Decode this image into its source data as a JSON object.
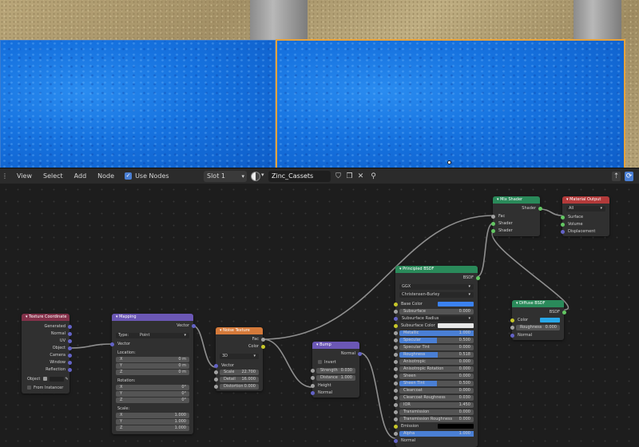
{
  "header": {
    "menus": [
      "View",
      "Select",
      "Add",
      "Node"
    ],
    "use_nodes_label": "Use Nodes",
    "slot_label": "Slot 1",
    "material_name": "Zinc_Cassets"
  },
  "nodes": {
    "texcoord": {
      "title": "Texture Coordinate",
      "outputs": [
        "Generated",
        "Normal",
        "UV",
        "Object",
        "Camera",
        "Window",
        "Reflection"
      ],
      "object_label": "Object",
      "from_instancer": "From Instancer"
    },
    "mapping": {
      "title": "Mapping",
      "output": "Vector",
      "type_label": "Type:",
      "type_value": "Point",
      "vector_input": "Vector",
      "location_label": "Location:",
      "location": [
        [
          "X",
          "0 m"
        ],
        [
          "Y",
          "0 m"
        ],
        [
          "Z",
          "0 m"
        ]
      ],
      "rotation_label": "Rotation:",
      "rotation": [
        [
          "X",
          "0°"
        ],
        [
          "Y",
          "0°"
        ],
        [
          "Z",
          "0°"
        ]
      ],
      "scale_label": "Scale:",
      "scale": [
        [
          "X",
          "1.000"
        ],
        [
          "Y",
          "1.000"
        ],
        [
          "Z",
          "1.000"
        ]
      ]
    },
    "noise": {
      "title": "Noise Texture",
      "outputs": [
        "Fac",
        "Color"
      ],
      "dimension": "3D",
      "vector_input": "Vector",
      "fields": [
        [
          "Scale",
          "22.700"
        ],
        [
          "Detail",
          "16.000"
        ],
        [
          "Distortion",
          "0.000"
        ]
      ]
    },
    "bump": {
      "title": "Bump",
      "output": "Normal",
      "invert": "Invert",
      "fields": [
        [
          "Strength",
          "0.030"
        ],
        [
          "Distance",
          "1.000"
        ]
      ],
      "inputs": [
        "Height",
        "Normal"
      ]
    },
    "principled": {
      "title": "Principled BSDF",
      "output": "BSDF",
      "distribution": "GGX",
      "subsurface_method": "Christensen-Burley",
      "rows": [
        {
          "label": "Base Color",
          "kind": "color",
          "color": "#3b82f0"
        },
        {
          "label": "Subsurface",
          "value": "0.000"
        },
        {
          "label": "Subsurface Radius",
          "kind": "select"
        },
        {
          "label": "Subsurface Color",
          "kind": "color",
          "color": "#e8e8e8"
        },
        {
          "label": "Metallic",
          "value": "1.000",
          "fill": 1.0
        },
        {
          "label": "Specular",
          "value": "0.500",
          "fill": 0.5
        },
        {
          "label": "Specular Tint",
          "value": "0.000"
        },
        {
          "label": "Roughness",
          "value": "0.518",
          "fill": 0.518
        },
        {
          "label": "Anisotropic",
          "value": "0.000"
        },
        {
          "label": "Anisotropic Rotation",
          "value": "0.000"
        },
        {
          "label": "Sheen",
          "value": "0.000"
        },
        {
          "label": "Sheen Tint",
          "value": "0.500",
          "fill": 0.5
        },
        {
          "label": "Clearcoat",
          "value": "0.000"
        },
        {
          "label": "Clearcoat Roughness",
          "value": "0.030"
        },
        {
          "label": "IOR",
          "value": "1.450"
        },
        {
          "label": "Transmission",
          "value": "0.000"
        },
        {
          "label": "Transmission Roughness",
          "value": "0.000"
        },
        {
          "label": "Emission",
          "kind": "color",
          "color": "#000000"
        },
        {
          "label": "Alpha",
          "value": "1.000",
          "fill": 1.0
        },
        {
          "label": "Normal",
          "kind": "socket"
        }
      ]
    },
    "mix": {
      "title": "Mix Shader",
      "output": "Shader",
      "inputs": [
        "Fac",
        "Shader",
        "Shader"
      ]
    },
    "output": {
      "title": "Material Output",
      "target": "All",
      "inputs": [
        "Surface",
        "Volume",
        "Displacement"
      ]
    },
    "diffuse": {
      "title": "Diffuse BSDF",
      "output": "BSDF",
      "color_label": "Color",
      "color": "#29a8e8",
      "roughness_label": "Roughness",
      "roughness_value": "0.000",
      "normal_label": "Normal"
    }
  }
}
